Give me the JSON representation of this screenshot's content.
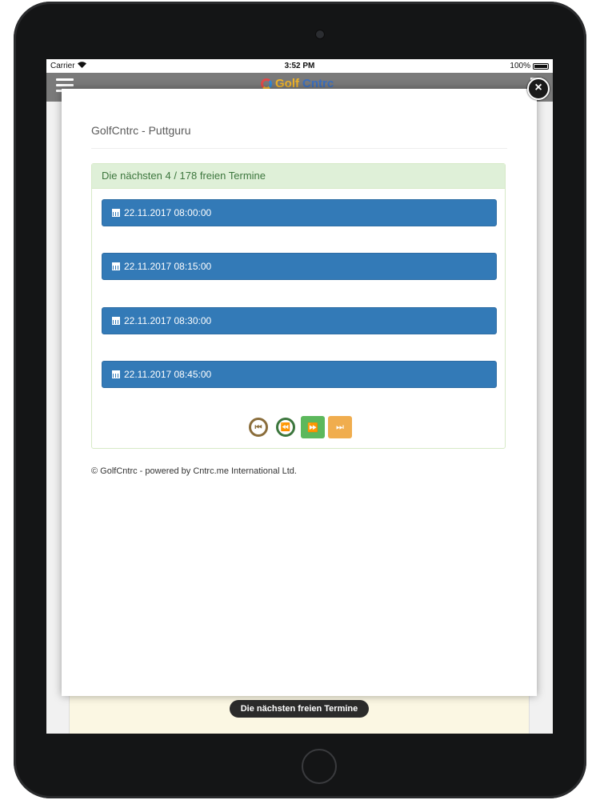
{
  "status_bar": {
    "carrier": "Carrier",
    "time": "3:52 PM",
    "battery": "100%"
  },
  "header": {
    "logo_prefix": "Golf",
    "logo_suffix": "Cntrc"
  },
  "modal": {
    "title": "GolfCntrc - Puttguru",
    "close_symbol": "×",
    "panel_heading": "Die nächsten 4 / 178 freien Termine",
    "slots": [
      {
        "label": "22.11.2017 08:00:00"
      },
      {
        "label": "22.11.2017 08:15:00"
      },
      {
        "label": "22.11.2017 08:30:00"
      },
      {
        "label": "22.11.2017 08:45:00"
      }
    ],
    "pager": {
      "first_icon": "first-page-icon",
      "prev_icon": "previous-page-icon",
      "next_icon": "next-page-icon",
      "last_icon": "last-page-icon"
    },
    "footer": "© GolfCntrc - powered by Cntrc.me International Ltd."
  },
  "bottom_toast": "Die nächsten freien Termine",
  "colors": {
    "slot_button": "#337ab7",
    "panel_heading_bg": "#dff0d8",
    "panel_heading_text": "#3c763d",
    "next_button": "#5cb85c",
    "last_button": "#f0ad4e"
  }
}
